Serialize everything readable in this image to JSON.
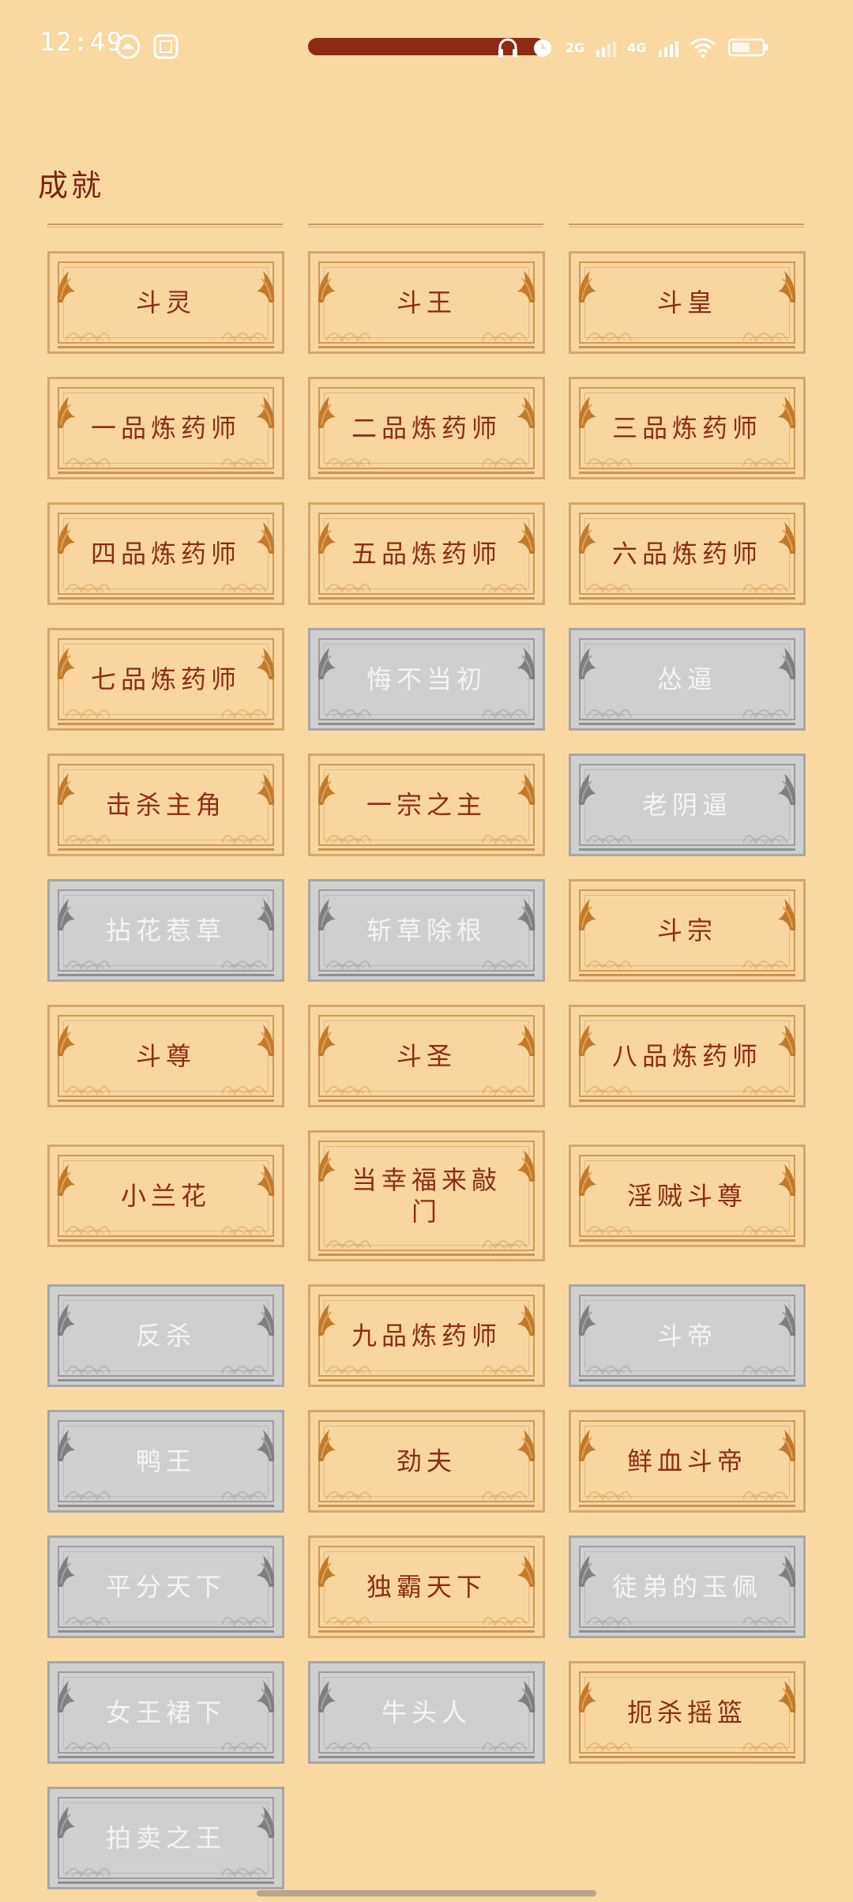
{
  "status_bar": {
    "time": "12:49",
    "net1": "2G",
    "net2": "4G",
    "progress_value": 0.82,
    "colors": {
      "progress": "#8c2a13"
    }
  },
  "section": {
    "title": "成就"
  },
  "colors": {
    "background": "#fad8a2",
    "unlocked_text": "#8b2d12",
    "locked_bg": "#cfcfcf",
    "locked_text": "#f4f4f4"
  },
  "achievements": [
    {
      "label": "斗灵",
      "unlocked": true
    },
    {
      "label": "斗王",
      "unlocked": true
    },
    {
      "label": "斗皇",
      "unlocked": true
    },
    {
      "label": "一品炼药师",
      "unlocked": true
    },
    {
      "label": "二品炼药师",
      "unlocked": true
    },
    {
      "label": "三品炼药师",
      "unlocked": true
    },
    {
      "label": "四品炼药师",
      "unlocked": true
    },
    {
      "label": "五品炼药师",
      "unlocked": true
    },
    {
      "label": "六品炼药师",
      "unlocked": true
    },
    {
      "label": "七品炼药师",
      "unlocked": true
    },
    {
      "label": "悔不当初",
      "unlocked": false
    },
    {
      "label": "怂逼",
      "unlocked": false
    },
    {
      "label": "击杀主角",
      "unlocked": true
    },
    {
      "label": "一宗之主",
      "unlocked": true
    },
    {
      "label": "老阴逼",
      "unlocked": false
    },
    {
      "label": "拈花惹草",
      "unlocked": false
    },
    {
      "label": "斩草除根",
      "unlocked": false
    },
    {
      "label": "斗宗",
      "unlocked": true
    },
    {
      "label": "斗尊",
      "unlocked": true
    },
    {
      "label": "斗圣",
      "unlocked": true
    },
    {
      "label": "八品炼药师",
      "unlocked": true
    },
    {
      "label": "小兰花",
      "unlocked": true
    },
    {
      "label": "当幸福来敲门",
      "unlocked": true
    },
    {
      "label": "淫贼斗尊",
      "unlocked": true
    },
    {
      "label": "反杀",
      "unlocked": false
    },
    {
      "label": "九品炼药师",
      "unlocked": true
    },
    {
      "label": "斗帝",
      "unlocked": false
    },
    {
      "label": "鸭王",
      "unlocked": false
    },
    {
      "label": "劲夫",
      "unlocked": true
    },
    {
      "label": "鲜血斗帝",
      "unlocked": true
    },
    {
      "label": "平分天下",
      "unlocked": false
    },
    {
      "label": "独霸天下",
      "unlocked": true
    },
    {
      "label": "徒弟的玉佩",
      "unlocked": false
    },
    {
      "label": "女王裙下",
      "unlocked": false
    },
    {
      "label": "牛头人",
      "unlocked": false
    },
    {
      "label": "扼杀摇篮",
      "unlocked": true
    },
    {
      "label": "拍卖之王",
      "unlocked": false
    }
  ]
}
